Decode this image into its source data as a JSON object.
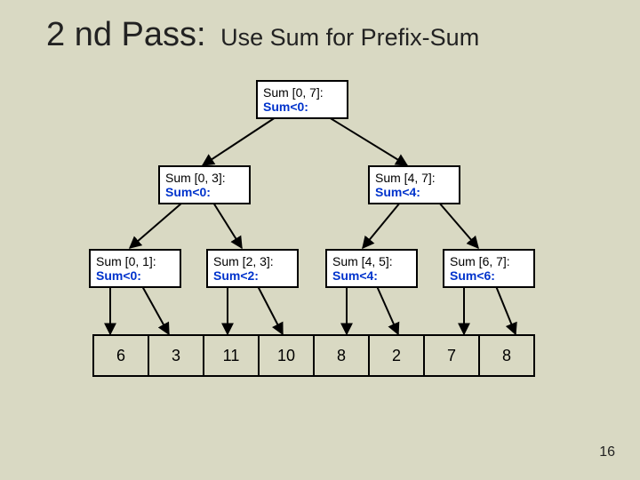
{
  "title": {
    "main": "2 nd Pass:",
    "sub": "Use Sum for Prefix-Sum"
  },
  "nodes": {
    "root": {
      "l1": "Sum [0, 7]:",
      "l2": "Sum<0:"
    },
    "n03": {
      "l1": "Sum [0, 3]:",
      "l2": "Sum<0:"
    },
    "n47": {
      "l1": "Sum [4, 7]:",
      "l2": "Sum<4:"
    },
    "n01": {
      "l1": "Sum [0, 1]:",
      "l2": "Sum<0:"
    },
    "n23": {
      "l1": "Sum [2, 3]:",
      "l2": "Sum<2:"
    },
    "n45": {
      "l1": "Sum [4, 5]:",
      "l2": "Sum<4:"
    },
    "n67": {
      "l1": "Sum [6, 7]:",
      "l2": "Sum<6:"
    }
  },
  "cells": [
    "6",
    "3",
    "11",
    "10",
    "8",
    "2",
    "7",
    "8"
  ],
  "page_number": "16",
  "chart_data": {
    "type": "table",
    "title": "2nd Pass: Use Sum for Prefix-Sum",
    "tree": {
      "range": "[0,7]",
      "prefix": "Sum<0",
      "children": [
        {
          "range": "[0,3]",
          "prefix": "Sum<0",
          "children": [
            {
              "range": "[0,1]",
              "prefix": "Sum<0"
            },
            {
              "range": "[2,3]",
              "prefix": "Sum<2"
            }
          ]
        },
        {
          "range": "[4,7]",
          "prefix": "Sum<4",
          "children": [
            {
              "range": "[4,5]",
              "prefix": "Sum<4"
            },
            {
              "range": "[6,7]",
              "prefix": "Sum<6"
            }
          ]
        }
      ]
    },
    "array_values": [
      6,
      3,
      11,
      10,
      8,
      2,
      7,
      8
    ]
  }
}
